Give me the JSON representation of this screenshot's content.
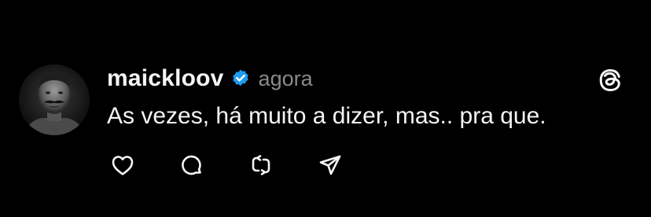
{
  "post": {
    "username": "maickloov",
    "verified": true,
    "timestamp": "agora",
    "text": "As vezes, há muito a dizer, mas.. pra que."
  },
  "icons": {
    "verified": "verified-badge-icon",
    "brand": "threads-logo-icon",
    "like": "heart-icon",
    "reply": "comment-bubble-icon",
    "repost": "repost-icon",
    "share": "send-icon"
  },
  "colors": {
    "background": "#000000",
    "text": "#f5f5f5",
    "muted": "#8a8a8a",
    "verified": "#1d9bf0"
  }
}
